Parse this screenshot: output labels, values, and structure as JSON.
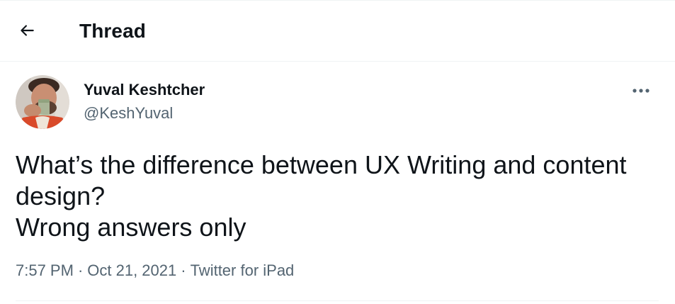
{
  "header": {
    "back_icon": "arrow-left-icon",
    "title": "Thread"
  },
  "tweet": {
    "avatar_icon": "user-avatar",
    "author_name": "Yuval Keshtcher",
    "author_handle": "@KeshYuval",
    "more_icon": "more-horizontal-icon",
    "text_lines": [
      "What’s the difference between UX Writing and content",
      "design?",
      "Wrong answers only"
    ],
    "time": "7:57 PM",
    "date": "Oct 21, 2021",
    "source": "Twitter for iPad",
    "separator": "·"
  },
  "colors": {
    "text_primary": "#0f1419",
    "text_secondary": "#536471",
    "divider": "#eff3f4",
    "background": "#ffffff"
  }
}
